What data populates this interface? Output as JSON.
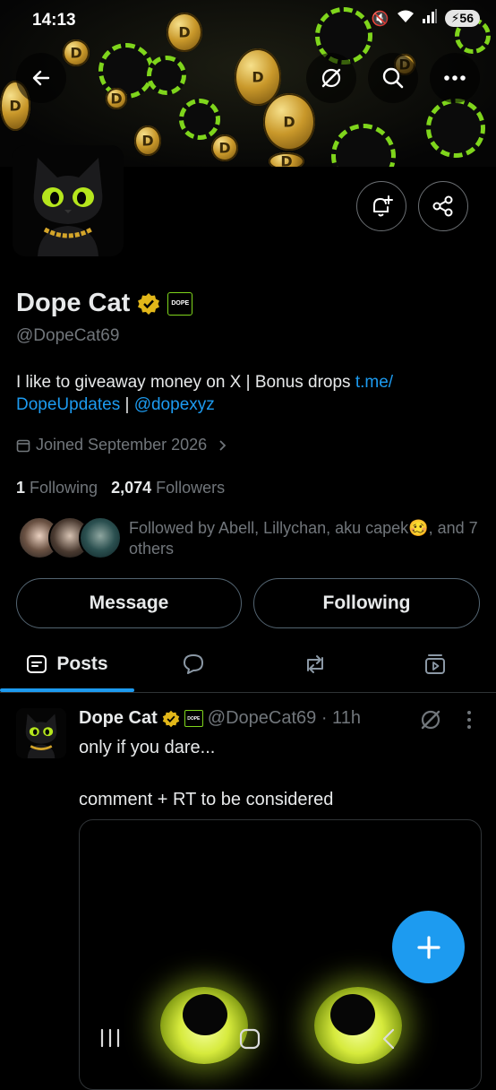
{
  "status_bar": {
    "time": "14:13",
    "battery": "56"
  },
  "profile": {
    "display_name": "Dope Cat",
    "badge_text": "DOPE",
    "handle": "@DopeCat69",
    "bio_text": "I like to giveaway money on X | Bonus drops ",
    "bio_link_1a": "t.me/",
    "bio_link_1b": "DopeUpdates",
    "bio_separator": " | ",
    "bio_link_2": "@dopexyz",
    "joined": "Joined September 2026",
    "following_count": "1",
    "following_label": "Following",
    "followers_count": "2,074",
    "followers_label": "Followers",
    "followed_by": "Followed by Abell, Lillychan, aku capek",
    "followed_by_emoji": "🥴",
    "followed_by_tail": ", and 7 others"
  },
  "buttons": {
    "message": "Message",
    "following": "Following"
  },
  "tabs": [
    {
      "label": "Posts",
      "icon": "posts-icon",
      "active": true
    },
    {
      "label": "",
      "icon": "replies-icon",
      "active": false
    },
    {
      "label": "",
      "icon": "reposts-icon",
      "active": false
    },
    {
      "label": "",
      "icon": "media-icon",
      "active": false
    }
  ],
  "post": {
    "author": "Dope Cat",
    "badge_text": "DOPE",
    "handle_time": "@DopeCat69 · 11h",
    "text": "only if you dare...\n\ncomment + RT to be considered"
  },
  "colors": {
    "accent": "#1d9bf0",
    "verified": "#e2b719",
    "chip_green": "#7fd51c",
    "muted": "#71767b"
  }
}
